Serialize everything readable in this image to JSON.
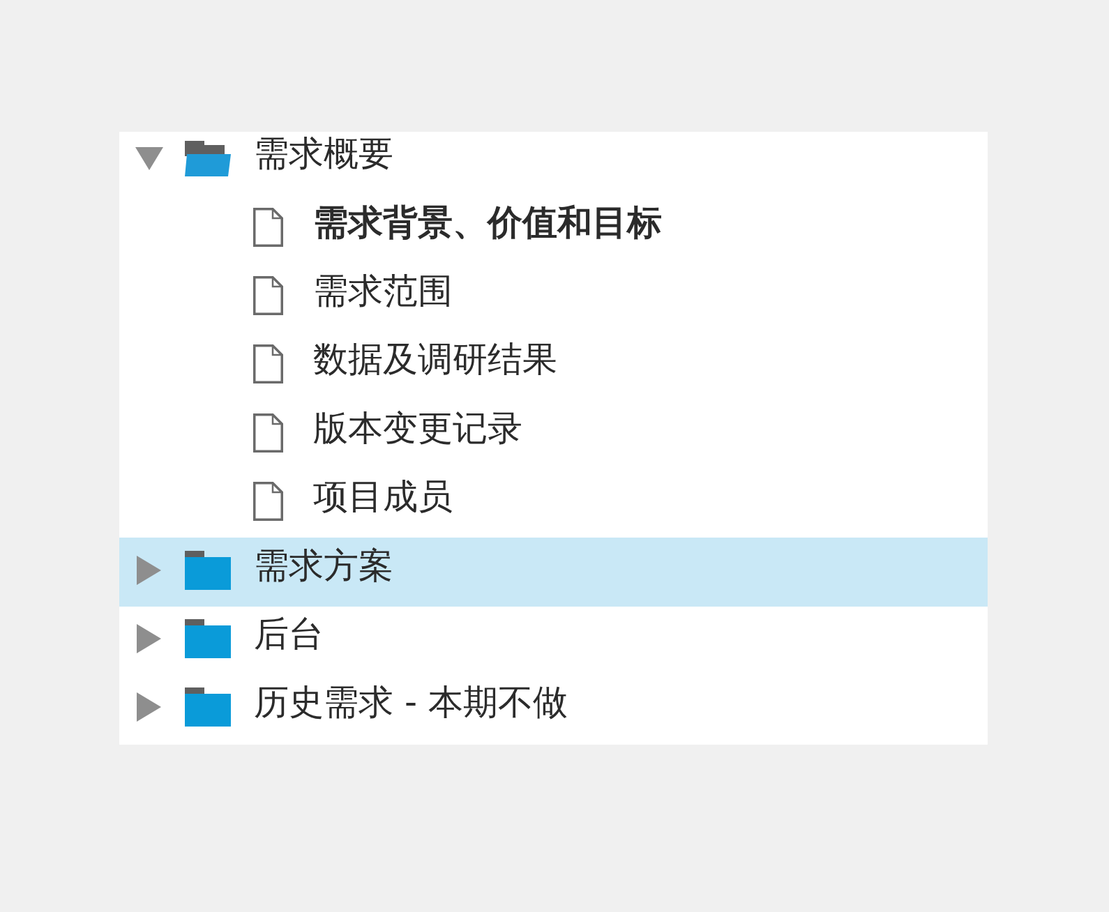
{
  "tree": [
    {
      "kind": "folder",
      "label": "需求概要",
      "expanded": true,
      "selected": false,
      "children": [
        {
          "kind": "file",
          "label": "需求背景、价值和目标",
          "selected": false,
          "active": true
        },
        {
          "kind": "file",
          "label": "需求范围",
          "selected": false,
          "active": false
        },
        {
          "kind": "file",
          "label": "数据及调研结果",
          "selected": false,
          "active": false
        },
        {
          "kind": "file",
          "label": "版本变更记录",
          "selected": false,
          "active": false
        },
        {
          "kind": "file",
          "label": "项目成员",
          "selected": false,
          "active": false
        }
      ]
    },
    {
      "kind": "folder",
      "label": "需求方案",
      "expanded": false,
      "selected": true
    },
    {
      "kind": "folder",
      "label": "后台",
      "expanded": false,
      "selected": false
    },
    {
      "kind": "folder",
      "label": "历史需求 - 本期不做",
      "expanded": false,
      "selected": false
    }
  ]
}
